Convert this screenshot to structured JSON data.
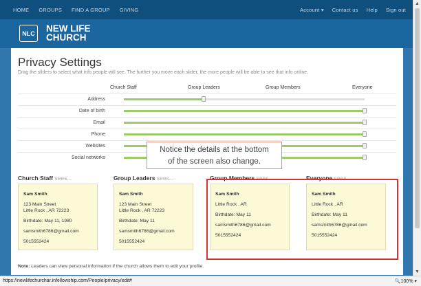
{
  "nav": {
    "home": "HOME",
    "groups": "GROUPS",
    "find_group": "FIND A GROUP",
    "giving": "GIVING",
    "account": "Account ▾",
    "contact": "Contact us",
    "help": "Help",
    "signout": "Sign out"
  },
  "brand": {
    "logo": "NLC",
    "line1": "NEW LIFE",
    "line2": "CHURCH"
  },
  "page": {
    "title": "Privacy Settings",
    "subtitle": "Drag the sliders to select what info people will see. The further you move each slider, the more people will be able to see that info online."
  },
  "columns": [
    "Church Staff",
    "Group Leaders",
    "Group Members",
    "Everyone"
  ],
  "rows": [
    {
      "label": "Address",
      "level": 0.33
    },
    {
      "label": "Date of birth",
      "level": 1.0
    },
    {
      "label": "Email",
      "level": 1.0
    },
    {
      "label": "Phone",
      "level": 1.0
    },
    {
      "label": "Websites",
      "level": 1.0
    },
    {
      "label": "Social networks",
      "level": 1.0
    }
  ],
  "callout": {
    "line1": "Notice the details at the bottom",
    "line2": "of the screen also change."
  },
  "sees_word": "sees...",
  "cards": [
    {
      "audience": "Church Staff",
      "name": "Sam Smith",
      "address1": "123 Main Street",
      "address2": "Little Rock , AR 72223",
      "birthdate": "Birthdate: May 11, 1980",
      "email": "samsmith6786@gmail.com",
      "phone": "5015552424"
    },
    {
      "audience": "Group Leaders",
      "name": "Sam Smith",
      "address1": "123 Main Street",
      "address2": "Little Rock , AR 72223",
      "birthdate": "Birthdate: May 11",
      "email": "samsmith6786@gmail.com",
      "phone": "5015552424"
    },
    {
      "audience": "Group Members",
      "name": "Sam Smith",
      "address1": "Little Rock , AR",
      "address2": "",
      "birthdate": "Birthdate: May 11",
      "email": "samsmith6786@gmail.com",
      "phone": "5015552424"
    },
    {
      "audience": "Everyone",
      "name": "Sam Smith",
      "address1": "Little Rock , AR",
      "address2": "",
      "birthdate": "Birthdate: May 11",
      "email": "samsmith6786@gmail.com",
      "phone": "5015552424"
    }
  ],
  "note": {
    "bold": "Note:",
    "text": " Leaders can view personal information if the church allows them to edit your profile."
  },
  "status": {
    "url": "https://newlifechurchar.infellowship.com/People/privacy/edit#",
    "zoom": "🔍100%  ▾"
  },
  "colors": {
    "nav_bg": "#0e4f7e",
    "brand_bg": "#1b669f",
    "page_bg": "#2f77ac",
    "slider_fill": "#9dcb6a",
    "card_bg": "#fcf9d7",
    "highlight": "#d53232"
  }
}
